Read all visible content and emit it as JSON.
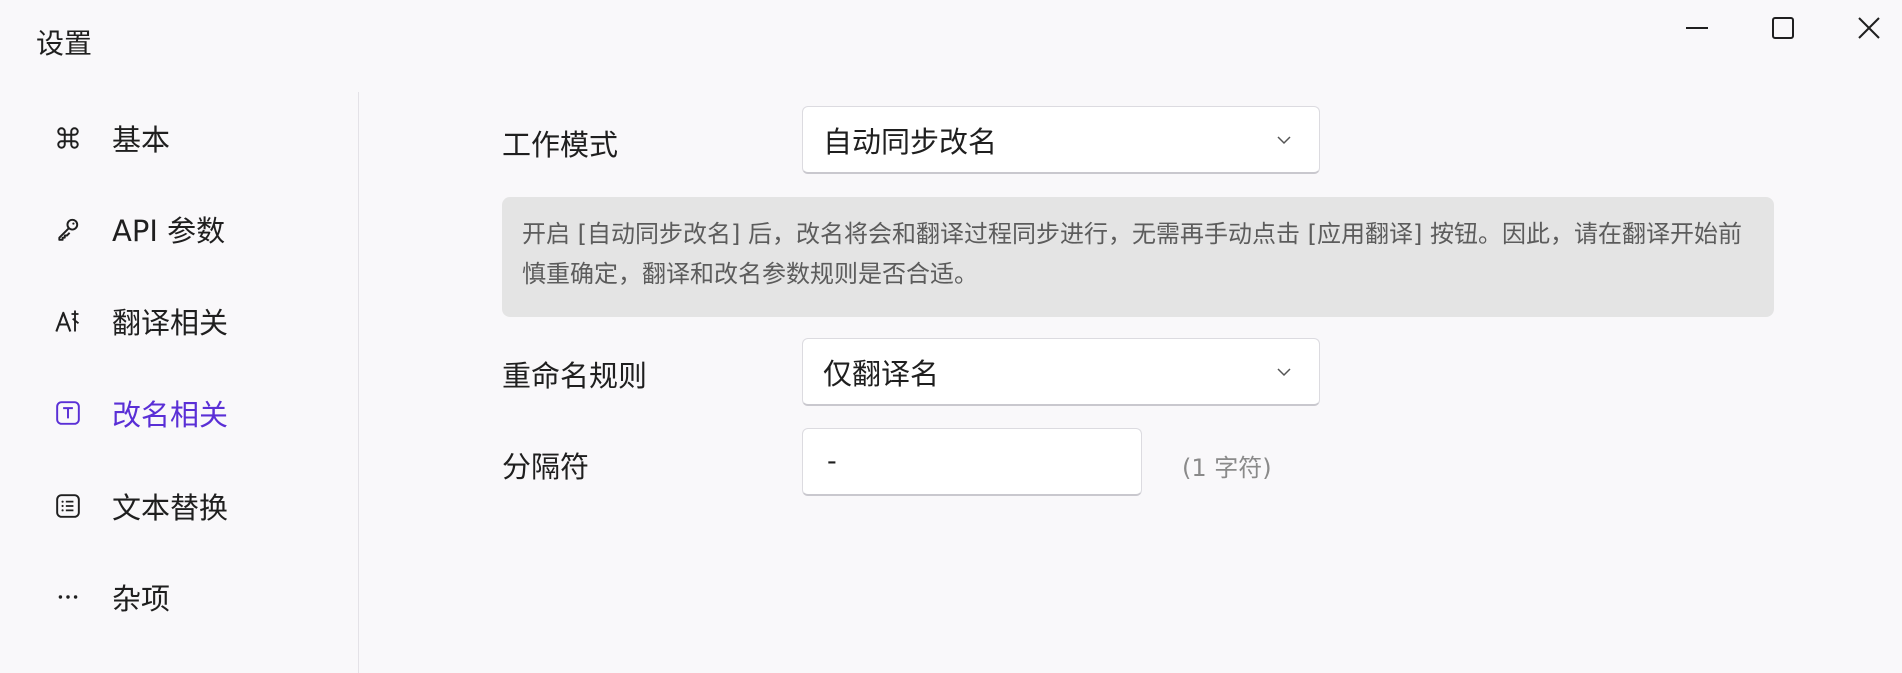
{
  "window": {
    "title": "设置",
    "controls": {
      "minimize": "minimize-icon",
      "maximize": "maximize-icon",
      "close": "close-icon"
    }
  },
  "sidebar": {
    "items": [
      {
        "label": "基本",
        "icon": "command-icon",
        "active": false
      },
      {
        "label": "API 参数",
        "icon": "key-icon",
        "active": false
      },
      {
        "label": "翻译相关",
        "icon": "translate-icon",
        "active": false
      },
      {
        "label": "改名相关",
        "icon": "text-box-icon",
        "active": true
      },
      {
        "label": "文本替换",
        "icon": "list-icon",
        "active": false
      },
      {
        "label": "杂项",
        "icon": "more-icon",
        "active": false
      }
    ]
  },
  "main": {
    "work_mode": {
      "label": "工作模式",
      "value": "自动同步改名"
    },
    "notice": "开启 [自动同步改名] 后，改名将会和翻译过程同步进行，无需再手动点击 [应用翻译] 按钮。因此，请在翻译开始前慎重确定，翻译和改名参数规则是否合适。",
    "rename_rule": {
      "label": "重命名规则",
      "value": "仅翻译名"
    },
    "separator": {
      "label": "分隔符",
      "value": "-",
      "hint": "(1 字符)"
    }
  },
  "colors": {
    "accent": "#5a2fd6",
    "background": "#f9f8fa",
    "notice_bg": "#e4e4e4"
  }
}
